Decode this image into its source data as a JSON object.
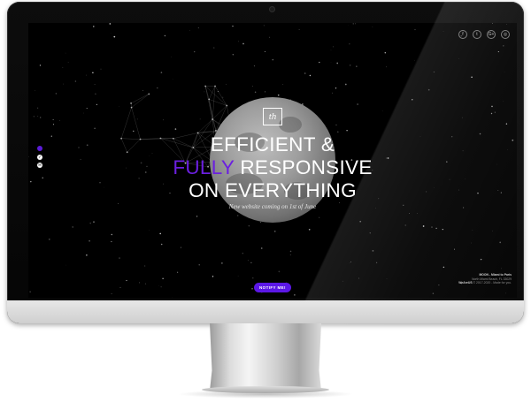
{
  "hero": {
    "logo_text": "th",
    "headline_line1": "EFFICIENT &",
    "headline_accent": "FULLY",
    "headline_line2_rest": " RESPONSIVE",
    "headline_line3": "ON EVERYTHING",
    "subtitle": "New website coming on 1st of June"
  },
  "social": [
    {
      "icon": "facebook-icon",
      "glyph": "f"
    },
    {
      "icon": "twitter-icon",
      "glyph": "t"
    },
    {
      "icon": "google-plus-icon",
      "glyph": "G+"
    },
    {
      "icon": "instagram-icon",
      "glyph": "◎"
    }
  ],
  "nav_dots": [
    {
      "glyph": "",
      "active": true
    },
    {
      "glyph": "✓",
      "active": false
    },
    {
      "glyph": "✉",
      "active": false
    }
  ],
  "notify_button": "NOTIFY ME!",
  "footer": {
    "line1": "MOON - Miami to Paris",
    "line2": "North Miami Beach, FL 33029",
    "line3_brand": "WeAreUS",
    "line3_rest": "© 2017-2020 - Made for you."
  },
  "colors": {
    "accent": "#6b1fe0",
    "button": "#5b17e6",
    "screen_background": "#000000"
  }
}
